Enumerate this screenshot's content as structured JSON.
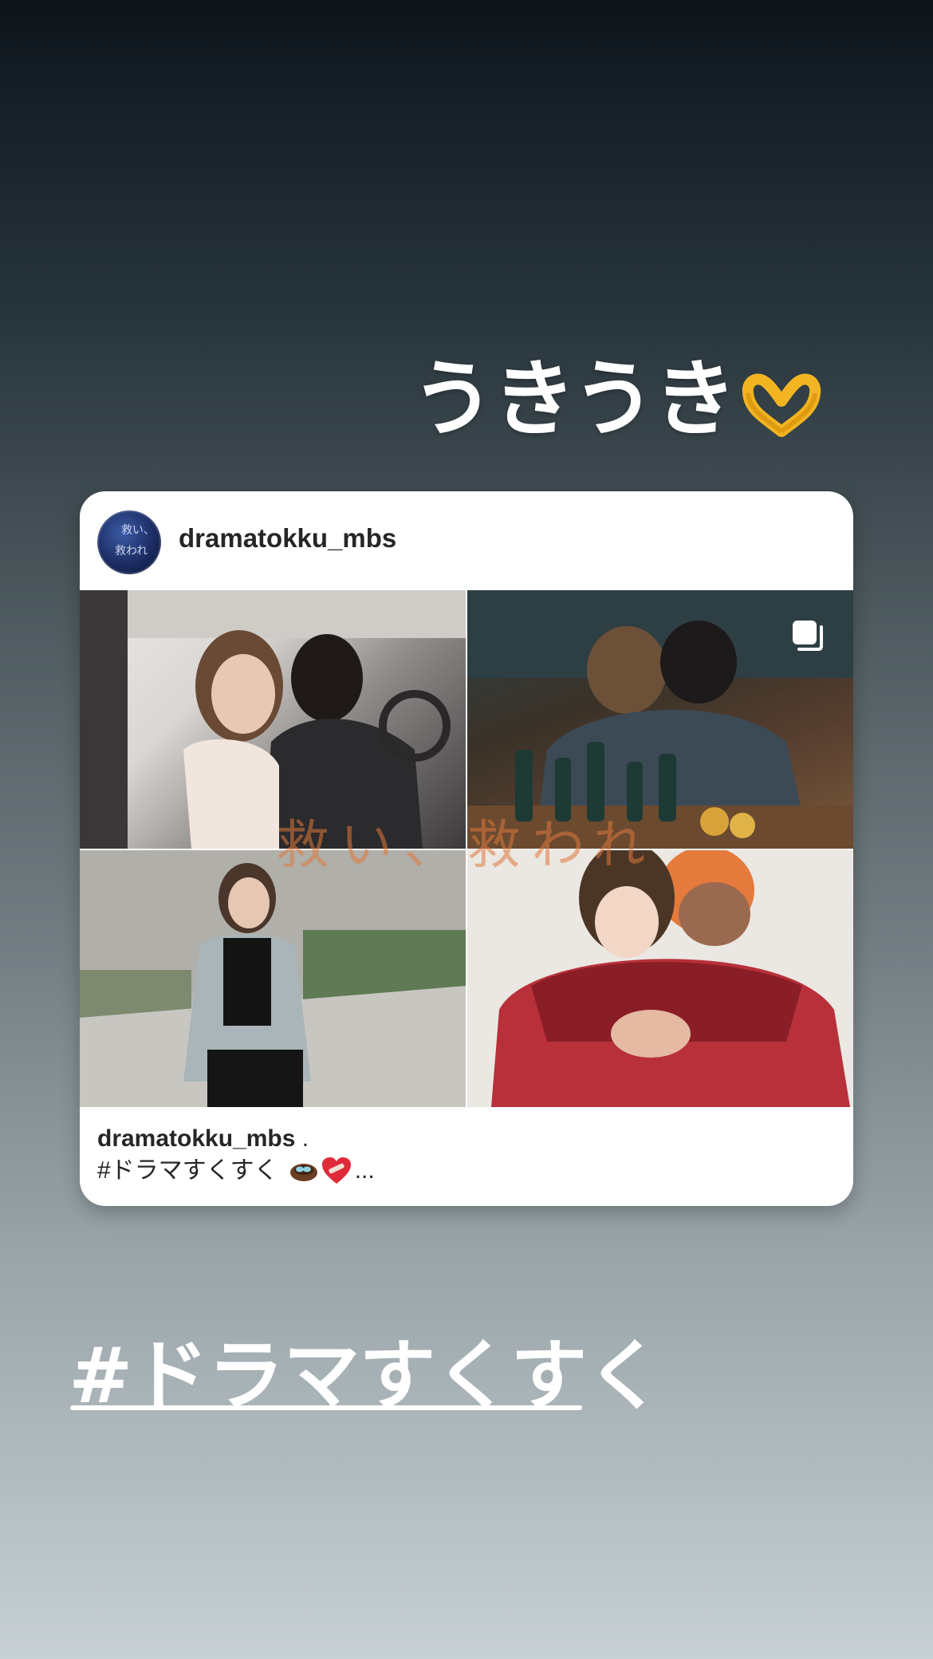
{
  "story": {
    "text": "うきうき",
    "text_emoji": "heart-hands-emoji",
    "hashtag": "#ドラマすくすく"
  },
  "post": {
    "username": "dramatokku_mbs",
    "avatar_text": [
      "救い、",
      "救われ"
    ],
    "overlay_title": "救い、救われ",
    "caption_user": "dramatokku_mbs",
    "caption_suffix": " .",
    "caption_text": "#ドラマすくすく",
    "caption_more": "...",
    "caption_emojis": [
      "nest-with-eggs-emoji",
      "mending-heart-emoji"
    ],
    "multi_icon": "carousel-icon"
  },
  "colors": {
    "background_top": "#0d151b",
    "background_bottom": "#c7d0d4",
    "card": "#ffffff",
    "text_dark": "#262626"
  }
}
